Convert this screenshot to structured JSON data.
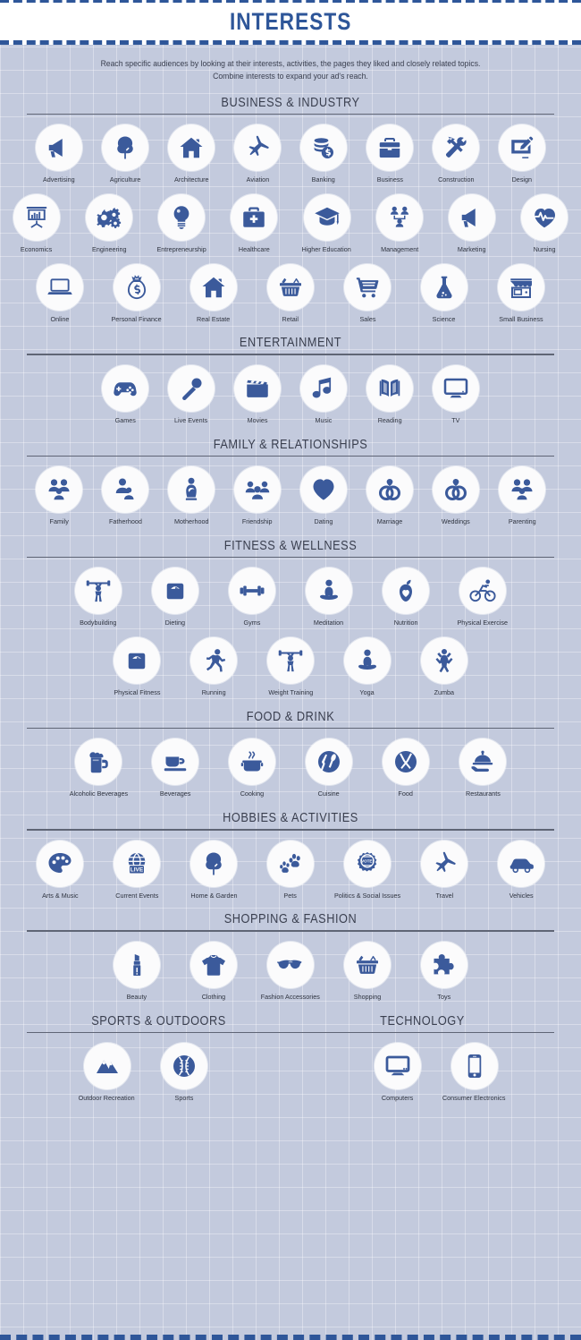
{
  "header": {
    "title": "INTERESTS",
    "accent_color": "#2e5699",
    "background_color": "#c3cadd",
    "text_color": "#3a3f4f"
  },
  "intro": {
    "line1": "Reach specific audiences by looking at their interests, activities, the pages they liked and closely related topics.",
    "line2": "Combine interests to expand your ad's reach."
  },
  "sections": [
    {
      "title": "BUSINESS & INDUSTRY",
      "rows": [
        [
          {
            "label": "Advertising",
            "icon": "megaphone-icon"
          },
          {
            "label": "Agriculture",
            "icon": "tree-icon"
          },
          {
            "label": "Architecture",
            "icon": "house-icon"
          },
          {
            "label": "Aviation",
            "icon": "airplane-icon"
          },
          {
            "label": "Banking",
            "icon": "coins-icon"
          },
          {
            "label": "Business",
            "icon": "briefcase-icon"
          },
          {
            "label": "Construction",
            "icon": "tools-icon"
          },
          {
            "label": "Design",
            "icon": "design-tablet-icon"
          }
        ],
        [
          {
            "label": "Economics",
            "icon": "presentation-chart-icon"
          },
          {
            "label": "Engineering",
            "icon": "gears-icon"
          },
          {
            "label": "Entrepreneurship",
            "icon": "lightbulb-icon"
          },
          {
            "label": "Healthcare",
            "icon": "medical-bag-icon"
          },
          {
            "label": "Higher Education",
            "icon": "graduation-cap-icon"
          },
          {
            "label": "Management",
            "icon": "org-chart-icon"
          },
          {
            "label": "Marketing",
            "icon": "megaphone-icon"
          },
          {
            "label": "Nursing",
            "icon": "heart-pulse-icon"
          }
        ],
        [
          {
            "label": "Online",
            "icon": "laptop-icon"
          },
          {
            "label": "Personal Finance",
            "icon": "money-bag-icon"
          },
          {
            "label": "Real Estate",
            "icon": "house-icon"
          },
          {
            "label": "Retail",
            "icon": "shopping-basket-icon"
          },
          {
            "label": "Sales",
            "icon": "shopping-cart-icon"
          },
          {
            "label": "Science",
            "icon": "flask-icon"
          },
          {
            "label": "Small Business",
            "icon": "storefront-icon"
          }
        ]
      ]
    },
    {
      "title": "ENTERTAINMENT",
      "rows": [
        [
          {
            "label": "Games",
            "icon": "gamepad-icon"
          },
          {
            "label": "Live Events",
            "icon": "microphone-icon"
          },
          {
            "label": "Movies",
            "icon": "clapperboard-icon"
          },
          {
            "label": "Music",
            "icon": "music-note-icon"
          },
          {
            "label": "Reading",
            "icon": "open-book-icon"
          },
          {
            "label": "TV",
            "icon": "television-icon"
          }
        ]
      ]
    },
    {
      "title": "FAMILY & RELATIONSHIPS",
      "rows": [
        [
          {
            "label": "Family",
            "icon": "family-group-icon"
          },
          {
            "label": "Fatherhood",
            "icon": "father-child-icon"
          },
          {
            "label": "Motherhood",
            "icon": "mother-baby-icon"
          },
          {
            "label": "Friendship",
            "icon": "friends-group-icon"
          },
          {
            "label": "Dating",
            "icon": "heart-icon"
          },
          {
            "label": "Marriage",
            "icon": "rings-heart-icon"
          },
          {
            "label": "Weddings",
            "icon": "rings-heart-icon"
          },
          {
            "label": "Parenting",
            "icon": "family-group-icon"
          }
        ]
      ]
    },
    {
      "title": "FITNESS & WELLNESS",
      "rows": [
        [
          {
            "label": "Bodybuilding",
            "icon": "weightlifter-icon"
          },
          {
            "label": "Dieting",
            "icon": "scale-icon"
          },
          {
            "label": "Gyms",
            "icon": "dumbbell-icon"
          },
          {
            "label": "Meditation",
            "icon": "meditation-icon"
          },
          {
            "label": "Nutrition",
            "icon": "apple-heart-icon"
          },
          {
            "label": "Physical Exercise",
            "icon": "cyclist-icon"
          }
        ],
        [
          {
            "label": "Physical Fitness",
            "icon": "scale-icon"
          },
          {
            "label": "Running",
            "icon": "runner-icon"
          },
          {
            "label": "Weight Training",
            "icon": "weightlifter-icon"
          },
          {
            "label": "Yoga",
            "icon": "meditation-icon"
          },
          {
            "label": "Zumba",
            "icon": "dancer-icon"
          }
        ]
      ]
    },
    {
      "title": "FOOD & DRINK",
      "rows": [
        [
          {
            "label": "Alcoholic Beverages",
            "icon": "beer-mug-icon"
          },
          {
            "label": "Beverages",
            "icon": "coffee-cup-icon"
          },
          {
            "label": "Cooking",
            "icon": "cooking-pot-icon"
          },
          {
            "label": "Cuisine",
            "icon": "fork-spoon-circle-icon"
          },
          {
            "label": "Food",
            "icon": "fork-knife-circle-icon"
          },
          {
            "label": "Restaurants",
            "icon": "serving-tray-icon"
          }
        ]
      ]
    },
    {
      "title": "HOBBIES & ACTIVITIES",
      "rows": [
        [
          {
            "label": "Arts & Music",
            "icon": "paint-palette-icon"
          },
          {
            "label": "Current Events",
            "icon": "live-globe-icon"
          },
          {
            "label": "Home & Garden",
            "icon": "tree-icon"
          },
          {
            "label": "Pets",
            "icon": "paw-prints-icon"
          },
          {
            "label": "Politics & Social Issues",
            "icon": "vote-badge-icon"
          },
          {
            "label": "Travel",
            "icon": "airplane-icon"
          },
          {
            "label": "Vehicles",
            "icon": "car-icon"
          }
        ]
      ]
    },
    {
      "title": "SHOPPING & FASHION",
      "rows": [
        [
          {
            "label": "Beauty",
            "icon": "lipstick-icon"
          },
          {
            "label": "Clothing",
            "icon": "tshirt-icon"
          },
          {
            "label": "Fashion Accessories",
            "icon": "sunglasses-icon"
          },
          {
            "label": "Shopping",
            "icon": "shopping-basket-icon"
          },
          {
            "label": "Toys",
            "icon": "puzzle-piece-icon"
          }
        ]
      ]
    }
  ],
  "split_section": {
    "left": {
      "title": "SPORTS & OUTDOORS",
      "items": [
        {
          "label": "Outdoor Recreation",
          "icon": "mountains-icon"
        },
        {
          "label": "Sports",
          "icon": "baseball-icon"
        }
      ]
    },
    "right": {
      "title": "TECHNOLOGY",
      "items": [
        {
          "label": "Computers",
          "icon": "desktop-monitor-icon"
        },
        {
          "label": "Consumer Electronics",
          "icon": "smartphone-icon"
        }
      ]
    }
  }
}
